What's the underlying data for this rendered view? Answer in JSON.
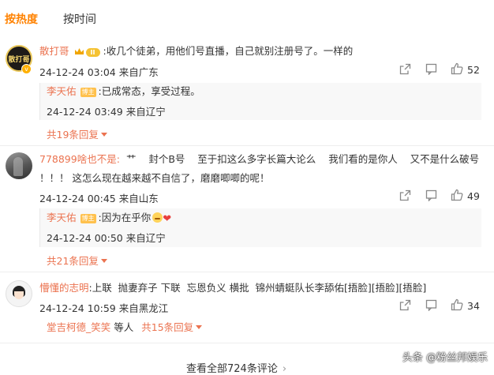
{
  "sort_tabs": {
    "hot": "按热度",
    "time": "按时间"
  },
  "comments": [
    {
      "user": "散打哥",
      "avatar_text": "散打哥",
      "level_badge": "II",
      "text": ":收几个徒弟，用他们号直播，自己就别注册号了。一样的",
      "time": "24-12-24 03:04",
      "location": "来自广东",
      "likes": "52",
      "reply": {
        "user": "李天佑",
        "badge": "博主",
        "text": ":已成常态，享受过程。",
        "time": "24-12-24 03:49",
        "location": "来自辽宁"
      },
      "more_replies": "共19条回复"
    },
    {
      "user": "778899啥也不是:",
      "text_line1": "艹    封个B号    至于扣这么多字长篇大论么    我们看的是你人    又不是什么破号",
      "text_line2": "！！！ 这怎么现在越来越不自信了，磨磨唧唧的呢！",
      "time": "24-12-24 00:45",
      "location": "来自山东",
      "likes": "49",
      "reply": {
        "user": "李天佑",
        "badge": "博主",
        "text": ":因为在乎你",
        "time": "24-12-24 00:50",
        "location": "来自辽宁"
      },
      "more_replies": "共21条回复"
    },
    {
      "user": "懵懂的志明",
      "text": ":上联  抛妻弃子 下联  忘恩负义 横批  锦州蜻蜓队长李舔佑[捂脸][捂脸][捂脸]",
      "time": "24-12-24 10:59",
      "location": "来自黑龙江",
      "likes": "34",
      "sub_user": "堂吉柯德_笑笑",
      "sub_text": "等人",
      "more_replies": "共15条回复"
    }
  ],
  "view_all": "查看全部724条评论",
  "watermark": "头条 @粉丝邦娱乐",
  "icons": [
    "share-icon",
    "comment-icon",
    "like-icon",
    "crown-icon",
    "verified-icon"
  ],
  "colors": {
    "accent": "#ff8200",
    "username": "#eb7350",
    "text": "#333333"
  }
}
